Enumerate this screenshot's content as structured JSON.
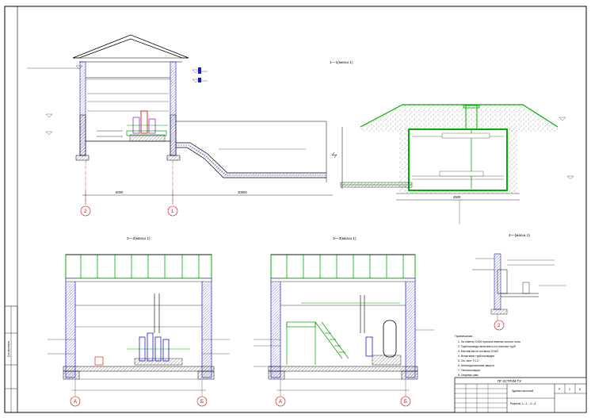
{
  "sheet": {
    "colors": {
      "wall": "#1a1acc",
      "green": "#00b000",
      "axis": "#d00000",
      "hatch": "#5a5a5a",
      "pump": "#8a2be2"
    }
  },
  "views": {
    "section_1": {
      "title": "1—1(масш 1)"
    },
    "section_2": {
      "title": "2—2(масш 1)"
    },
    "section_3": {
      "title": "3—3(масш 1)"
    },
    "node_4": {
      "title": "4—(масш 1)"
    }
  },
  "axes": {
    "top_left": "2",
    "top_right": "1",
    "sec2_left": "A",
    "sec2_right": "Б",
    "sec3_left": "A",
    "sec3_right": "Б",
    "node": "2"
  },
  "dims": {
    "top_span": "30000",
    "top_left_dim": "6000",
    "tank_width": "4500"
  },
  "notes": {
    "header": "Примечания:",
    "lines": [
      "1. За отметку 0.000 принята отметка чистого пола",
      "2. Трубопроводы выполнить из стальных труб",
      "3. Монтаж вести согласно СНиП",
      "4. Испытание трубопроводов",
      "5. См. лист ТХ-2",
      "6. Антикоррозионная защита",
      "7. Теплоизоляция",
      "8. Сварные швы"
    ]
  },
  "stamp": {
    "code": "ПГ-2СТРУМ-ТХ",
    "title": "Здание насосной",
    "subtitle": "Разрезы 1—1 .. 4—4",
    "stage": "Р",
    "sheet": "2",
    "sheets": "8",
    "side_strip": "Согласовано"
  }
}
